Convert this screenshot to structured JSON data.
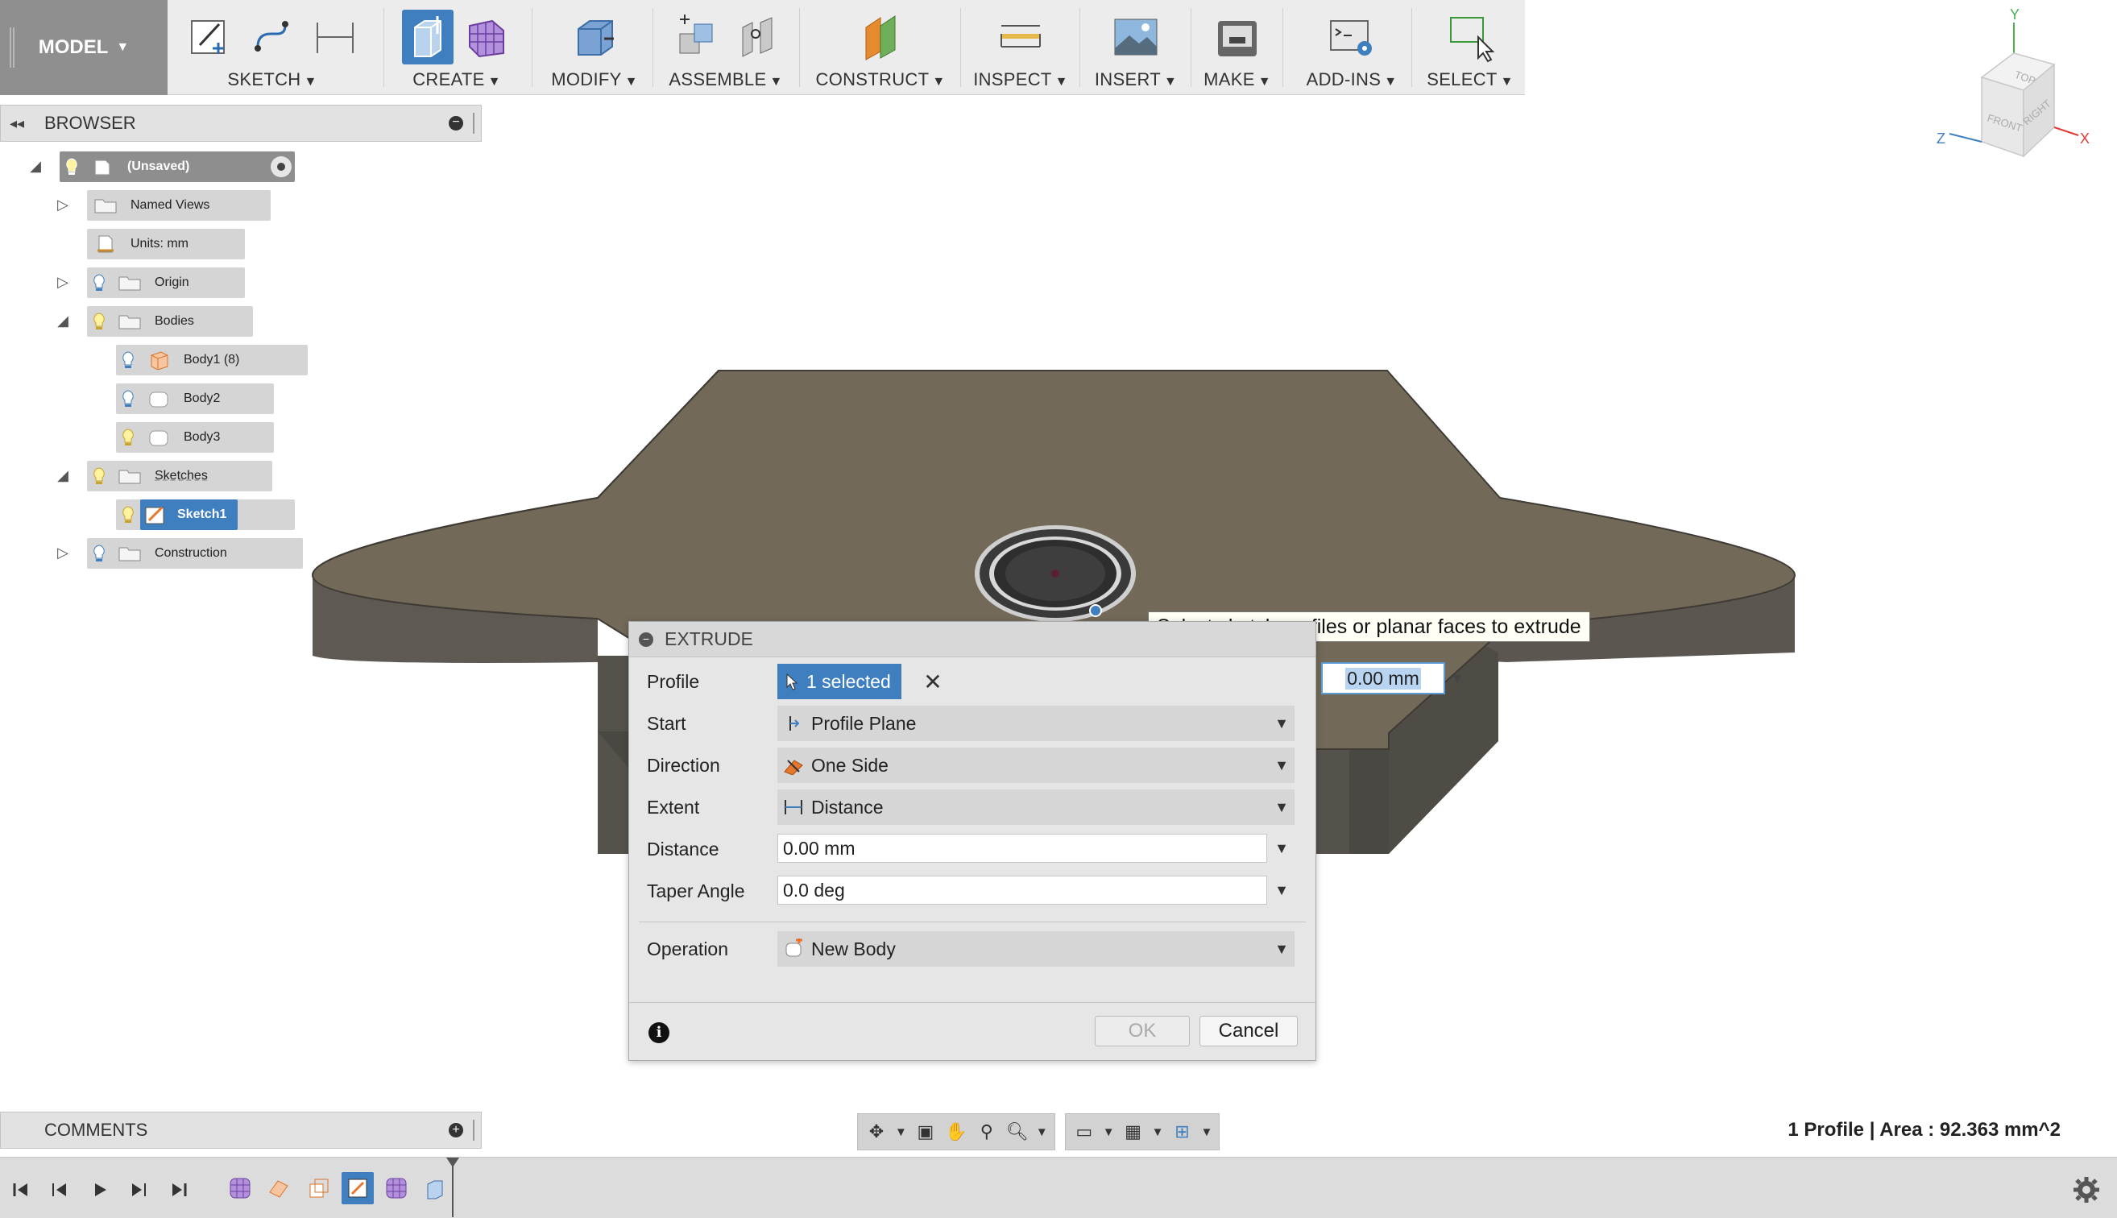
{
  "toolbar": {
    "workspace": "MODEL",
    "groups": [
      {
        "label": "SKETCH"
      },
      {
        "label": "CREATE"
      },
      {
        "label": "MODIFY"
      },
      {
        "label": "ASSEMBLE"
      },
      {
        "label": "CONSTRUCT"
      },
      {
        "label": "INSPECT"
      },
      {
        "label": "INSERT"
      },
      {
        "label": "MAKE"
      },
      {
        "label": "ADD-INS"
      },
      {
        "label": "SELECT"
      }
    ]
  },
  "viewcube": {
    "top": "TOP",
    "front": "FRONT",
    "right": "RIGHT",
    "axis_x": "X",
    "axis_y": "Y",
    "axis_z": "Z"
  },
  "browser": {
    "title": "BROWSER",
    "root": "(Unsaved)",
    "items": [
      {
        "label": "Named Views"
      },
      {
        "label": "Units: mm"
      },
      {
        "label": "Origin"
      },
      {
        "label": "Bodies"
      },
      {
        "label": "Body1 (8)"
      },
      {
        "label": "Body2"
      },
      {
        "label": "Body3"
      },
      {
        "label": "Sketches"
      },
      {
        "label": "Sketch1"
      },
      {
        "label": "Construction"
      }
    ]
  },
  "tooltip": "Select sketch profiles or planar faces to extrude",
  "distance_float": "0.00 mm",
  "extrude": {
    "title": "EXTRUDE",
    "rows": {
      "profile": {
        "label": "Profile",
        "value": "1 selected"
      },
      "start": {
        "label": "Start",
        "value": "Profile Plane"
      },
      "direction": {
        "label": "Direction",
        "value": "One Side"
      },
      "extent": {
        "label": "Extent",
        "value": "Distance"
      },
      "distance": {
        "label": "Distance",
        "value": "0.00 mm"
      },
      "taper": {
        "label": "Taper Angle",
        "value": "0.0 deg"
      },
      "operation": {
        "label": "Operation",
        "value": "New Body"
      }
    },
    "ok": "OK",
    "cancel": "Cancel"
  },
  "comments": {
    "title": "COMMENTS"
  },
  "status": "1 Profile | Area : 92.363 mm^2",
  "colors": {
    "accent": "#3f7fc0",
    "model_top": "#736959",
    "model_side": "#5e5a53"
  }
}
